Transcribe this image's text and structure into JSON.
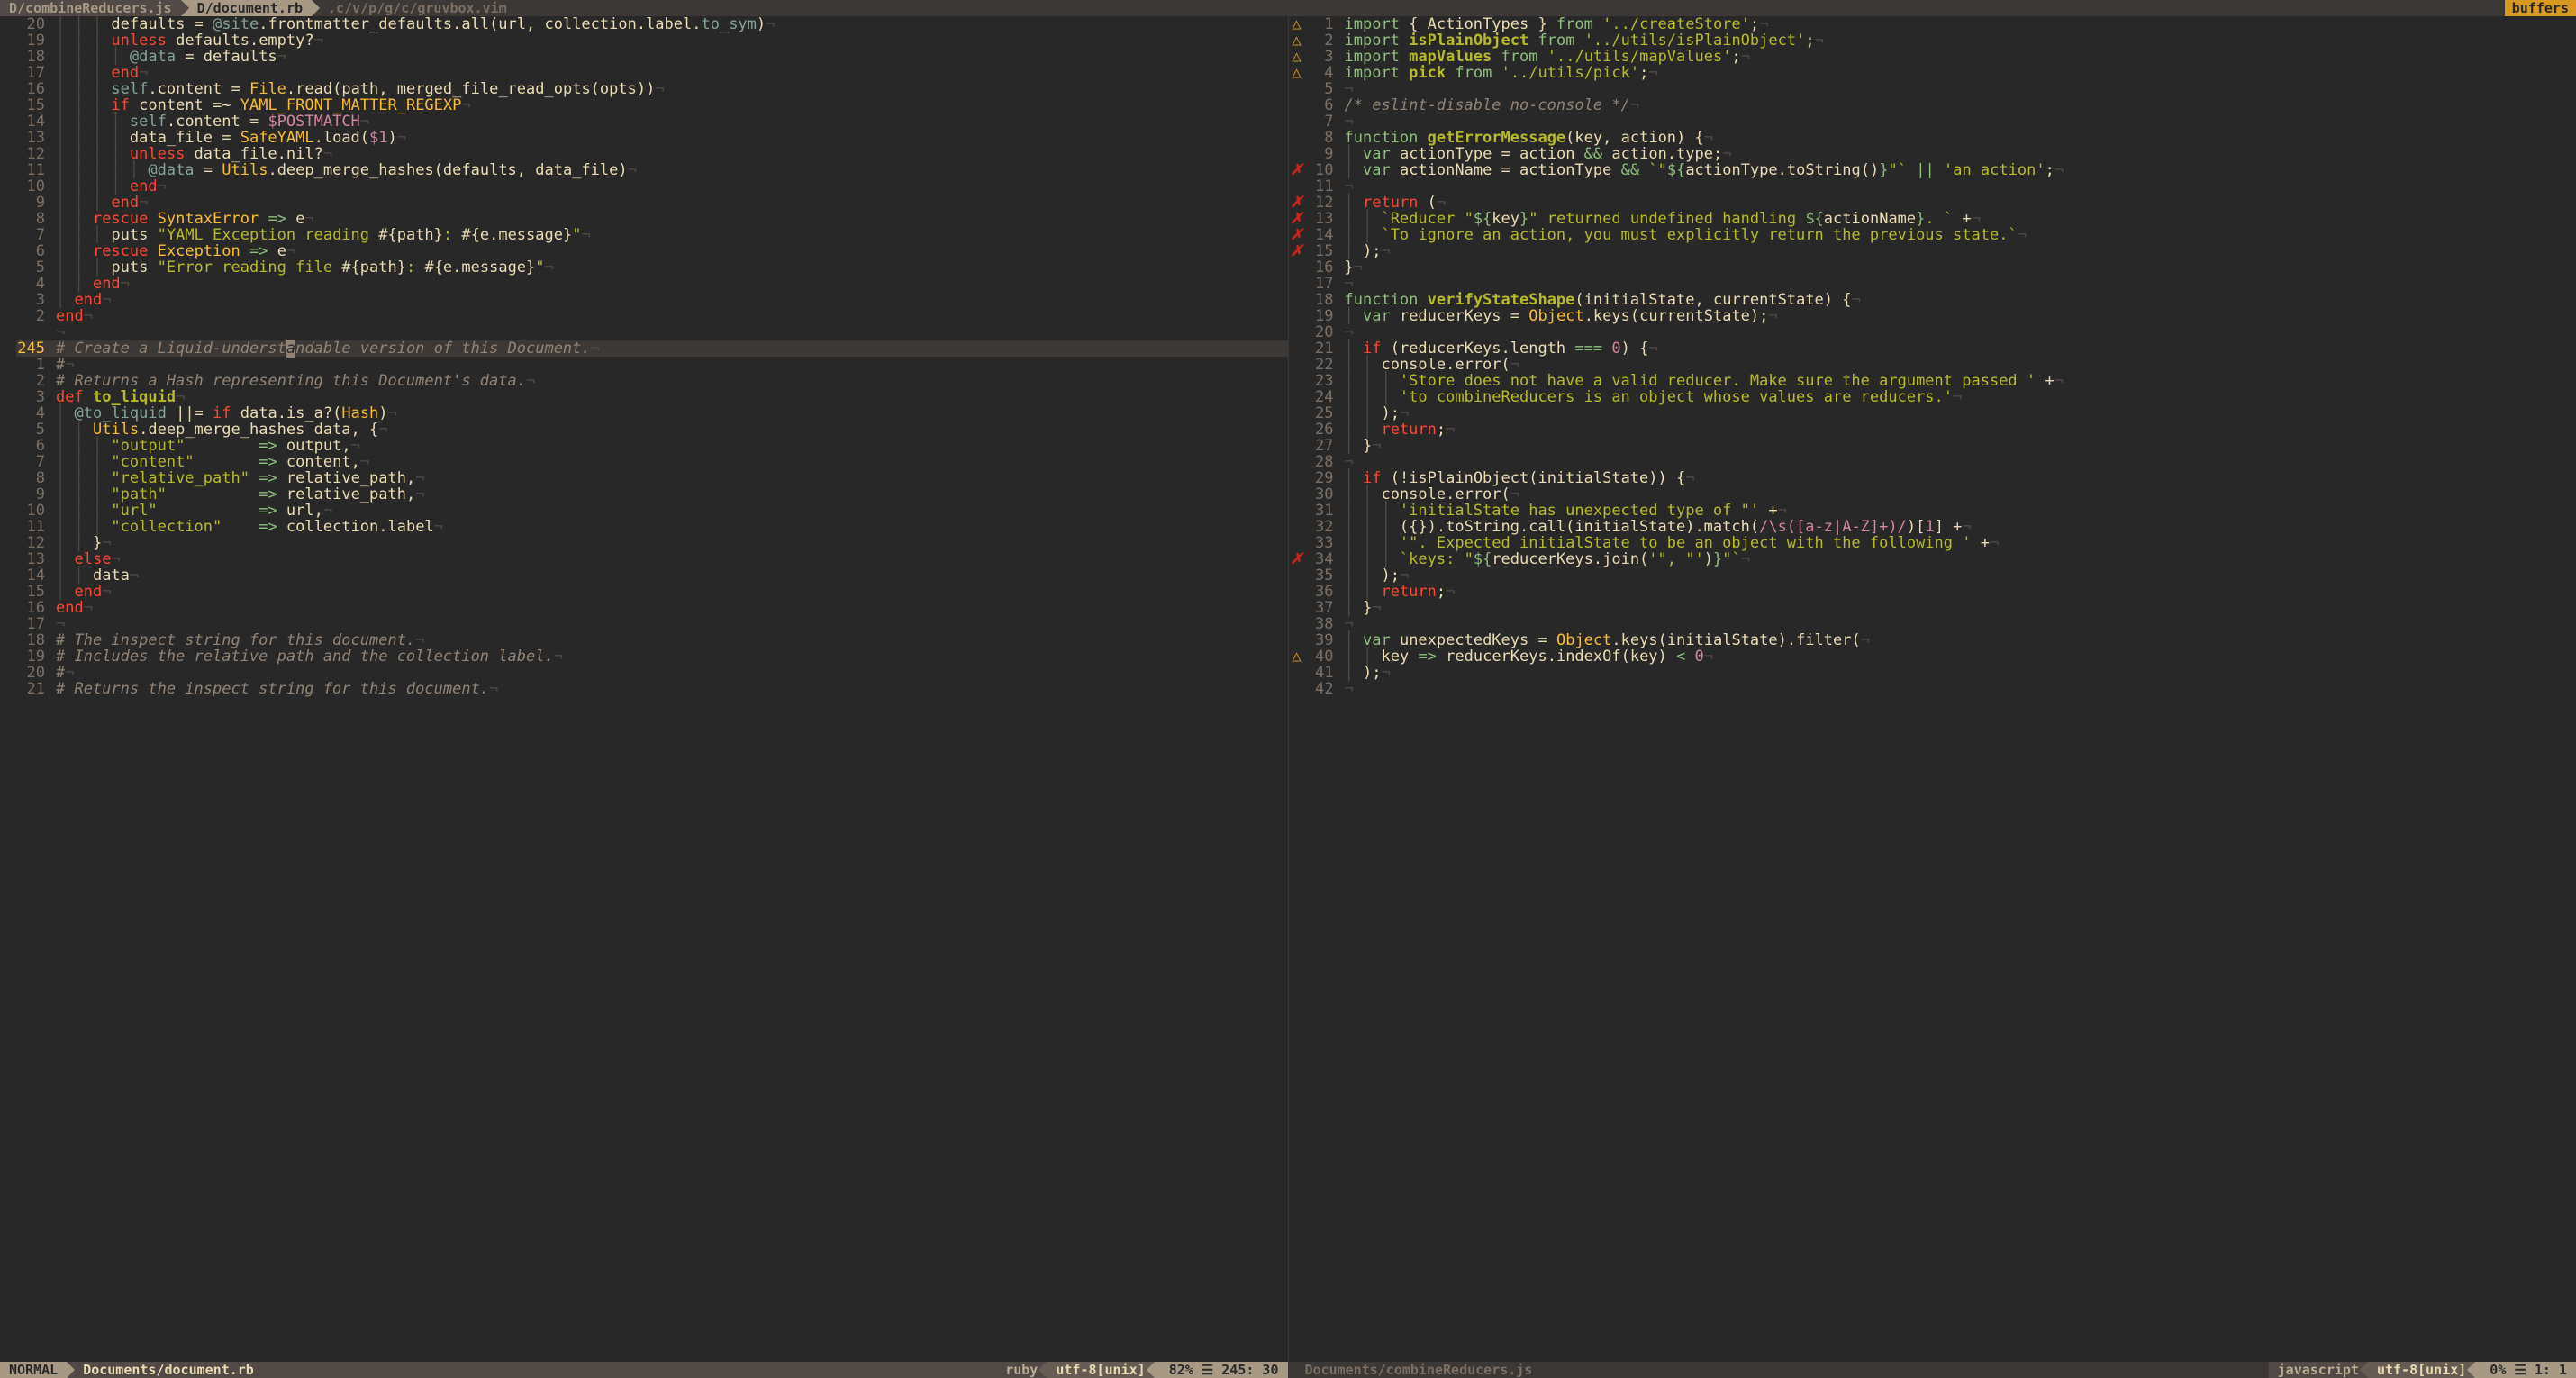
{
  "tabs": {
    "items": [
      {
        "label": "D/combineReducers.js",
        "active": false
      },
      {
        "label": "D/document.rb",
        "active": true
      }
    ],
    "path": ".c/v/p/g/c/gruvbox.vim",
    "right": "buffers"
  },
  "left": {
    "status": {
      "mode": "NORMAL",
      "file": "Documents/document.rb",
      "filetype": "ruby",
      "encoding": "utf-8[unix]",
      "percent": "82%",
      "pos": "245: 30"
    },
    "lines": [
      {
        "n": "20",
        "s": "",
        "html": "<span class='indent'>│ │ │ </span>defaults = <span class='sym'>@site</span>.frontmatter_defaults.all(url, collection.label.<span class='sym'>to_sym</span>)<span class='eol'>¬</span>"
      },
      {
        "n": "19",
        "s": "",
        "html": "<span class='indent'>│ │ │ </span><span class='kw'>unless</span> defaults.empty?<span class='eol'>¬</span>"
      },
      {
        "n": "18",
        "s": "",
        "html": "<span class='indent'>│ │ │ │ </span><span class='sym'>@data</span> = defaults<span class='eol'>¬</span>"
      },
      {
        "n": "17",
        "s": "",
        "html": "<span class='indent'>│ │ │ </span><span class='kw'>end</span><span class='eol'>¬</span>"
      },
      {
        "n": "16",
        "s": "",
        "html": "<span class='indent'>│ │ │ </span><span class='sym'>self</span>.content = <span class='type'>File</span>.read(path, merged_file_read_opts(opts))<span class='eol'>¬</span>"
      },
      {
        "n": "15",
        "s": "",
        "html": "<span class='indent'>│ │ │ </span><span class='kw'>if</span> content =~ <span class='type'>YAML_FRONT_MATTER_REGEXP</span><span class='eol'>¬</span>"
      },
      {
        "n": "14",
        "s": "",
        "html": "<span class='indent'>│ │ │ │ </span><span class='sym'>self</span>.content = <span class='spec'>$POSTMATCH</span><span class='eol'>¬</span>"
      },
      {
        "n": "13",
        "s": "",
        "html": "<span class='indent'>│ │ │ │ </span>data_file = <span class='type'>SafeYAML</span>.load(<span class='spec'>$1</span>)<span class='eol'>¬</span>"
      },
      {
        "n": "12",
        "s": "",
        "html": "<span class='indent'>│ │ │ │ </span><span class='kw'>unless</span> data_file.nil?<span class='eol'>¬</span>"
      },
      {
        "n": "11",
        "s": "",
        "html": "<span class='indent'>│ │ │ │ │ </span><span class='sym'>@data</span> = <span class='type'>Utils</span>.deep_merge_hashes(defaults, data_file)<span class='eol'>¬</span>"
      },
      {
        "n": "10",
        "s": "",
        "html": "<span class='indent'>│ │ │ │ </span><span class='kw'>end</span><span class='eol'>¬</span>"
      },
      {
        "n": "9",
        "s": "",
        "html": "<span class='indent'>│ │ │ </span><span class='kw'>end</span><span class='eol'>¬</span>"
      },
      {
        "n": "8",
        "s": "",
        "html": "<span class='indent'>│ │ </span><span class='kw'>rescue</span> <span class='type'>SyntaxError</span> <span class='op'>=></span> e<span class='eol'>¬</span>"
      },
      {
        "n": "7",
        "s": "",
        "html": "<span class='indent'>│ │ │ </span>puts <span class='str'>\"YAML Exception reading </span><span class='id'>#{path}</span><span class='str'>: </span><span class='id'>#{e.message}</span><span class='str'>\"</span><span class='eol'>¬</span>"
      },
      {
        "n": "6",
        "s": "",
        "html": "<span class='indent'>│ │ </span><span class='kw'>rescue</span> <span class='type'>Exception</span> <span class='op'>=></span> e<span class='eol'>¬</span>"
      },
      {
        "n": "5",
        "s": "",
        "html": "<span class='indent'>│ │ │ </span>puts <span class='str'>\"Error reading file </span><span class='id'>#{path}</span><span class='str'>: </span><span class='id'>#{e.message}</span><span class='str'>\"</span><span class='eol'>¬</span>"
      },
      {
        "n": "4",
        "s": "",
        "html": "<span class='indent'>│ │ </span><span class='kw'>end</span><span class='eol'>¬</span>"
      },
      {
        "n": "3",
        "s": "",
        "html": "<span class='indent'>│ </span><span class='kw'>end</span><span class='eol'>¬</span>"
      },
      {
        "n": "2",
        "s": "",
        "html": "<span class='kw'>end</span><span class='eol'>¬</span>"
      },
      {
        "n": "",
        "s": "",
        "html": "<span class='eol'>¬</span>",
        "abs": ""
      },
      {
        "n": "245",
        "s": "",
        "cursor": true,
        "html": "<span class='com'># Create a Liquid-underst<span class='cursor-ch'>a</span>ndable version of this Document.</span><span class='eol'>¬</span>"
      },
      {
        "n": "1",
        "s": "",
        "html": "<span class='com'>#</span><span class='eol'>¬</span>"
      },
      {
        "n": "2",
        "s": "",
        "html": "<span class='com'># Returns a Hash representing this Document's data.</span><span class='eol'>¬</span>"
      },
      {
        "n": "3",
        "s": "",
        "html": "<span class='kw'>def</span> <span class='fn'>to_liquid</span><span class='eol'>¬</span>"
      },
      {
        "n": "4",
        "s": "",
        "html": "<span class='indent'>│ </span><span class='sym'>@to_liquid</span> ||= <span class='kw'>if</span> data.is_a?(<span class='type'>Hash</span>)<span class='eol'>¬</span>"
      },
      {
        "n": "5",
        "s": "",
        "html": "<span class='indent'>│ │ </span><span class='type'>Utils</span>.deep_merge_hashes data, {<span class='eol'>¬</span>"
      },
      {
        "n": "6",
        "s": "",
        "html": "<span class='indent'>│ │ │ </span><span class='str'>\"output\"</span>        <span class='op'>=></span> output,<span class='eol'>¬</span>"
      },
      {
        "n": "7",
        "s": "",
        "html": "<span class='indent'>│ │ │ </span><span class='str'>\"content\"</span>       <span class='op'>=></span> content,<span class='eol'>¬</span>"
      },
      {
        "n": "8",
        "s": "",
        "html": "<span class='indent'>│ │ │ </span><span class='str'>\"relative_path\"</span> <span class='op'>=></span> relative_path,<span class='eol'>¬</span>"
      },
      {
        "n": "9",
        "s": "",
        "html": "<span class='indent'>│ │ │ </span><span class='str'>\"path\"</span>          <span class='op'>=></span> relative_path,<span class='eol'>¬</span>"
      },
      {
        "n": "10",
        "s": "",
        "html": "<span class='indent'>│ │ │ </span><span class='str'>\"url\"</span>           <span class='op'>=></span> url,<span class='eol'>¬</span>"
      },
      {
        "n": "11",
        "s": "",
        "html": "<span class='indent'>│ │ │ </span><span class='str'>\"collection\"</span>    <span class='op'>=></span> collection.label<span class='eol'>¬</span>"
      },
      {
        "n": "12",
        "s": "",
        "html": "<span class='indent'>│ │ </span>}<span class='eol'>¬</span>"
      },
      {
        "n": "13",
        "s": "",
        "html": "<span class='indent'>│ </span><span class='kw'>else</span><span class='eol'>¬</span>"
      },
      {
        "n": "14",
        "s": "",
        "html": "<span class='indent'>│ │ </span>data<span class='eol'>¬</span>"
      },
      {
        "n": "15",
        "s": "",
        "html": "<span class='indent'>│ </span><span class='kw'>end</span><span class='eol'>¬</span>"
      },
      {
        "n": "16",
        "s": "",
        "html": "<span class='kw'>end</span><span class='eol'>¬</span>"
      },
      {
        "n": "17",
        "s": "",
        "html": "<span class='eol'>¬</span>"
      },
      {
        "n": "18",
        "s": "",
        "html": "<span class='com'># The inspect string for this document.</span><span class='eol'>¬</span>"
      },
      {
        "n": "19",
        "s": "",
        "html": "<span class='com'># Includes the relative path and the collection label.</span><span class='eol'>¬</span>"
      },
      {
        "n": "20",
        "s": "",
        "html": "<span class='com'>#</span><span class='eol'>¬</span>"
      },
      {
        "n": "21",
        "s": "",
        "html": "<span class='com'># Returns the inspect string for this document.</span><span class='eol'>¬</span>"
      }
    ]
  },
  "right": {
    "status": {
      "file": "Documents/combineReducers.js",
      "filetype": "javascript",
      "encoding": "utf-8[unix]",
      "percent": "0%",
      "pos": "1:  1"
    },
    "lines": [
      {
        "n": "1",
        "s": "△",
        "sc": "warn",
        "html": "<span class='op'>import</span> { ActionTypes } <span class='op'>from</span> <span class='str'>'../createStore'</span>;<span class='eol'>¬</span>"
      },
      {
        "n": "2",
        "s": "△",
        "sc": "warn",
        "html": "<span class='op'>import</span> <span class='fn'>isPlainObject</span> <span class='op'>from</span> <span class='str'>'../utils/isPlainObject'</span>;<span class='eol'>¬</span>"
      },
      {
        "n": "3",
        "s": "△",
        "sc": "warn",
        "html": "<span class='op'>import</span> <span class='fn'>mapValues</span> <span class='op'>from</span> <span class='str'>'../utils/mapValues'</span>;<span class='eol'>¬</span>"
      },
      {
        "n": "4",
        "s": "△",
        "sc": "warn",
        "html": "<span class='op'>import</span> <span class='fn'>pick</span> <span class='op'>from</span> <span class='str'>'../utils/pick'</span>;<span class='eol'>¬</span>"
      },
      {
        "n": "5",
        "s": "",
        "html": "<span class='eol'>¬</span>"
      },
      {
        "n": "6",
        "s": "",
        "html": "<span class='com'>/* eslint-disable no-console */</span><span class='eol'>¬</span>"
      },
      {
        "n": "7",
        "s": "",
        "html": "<span class='eol'>¬</span>"
      },
      {
        "n": "8",
        "s": "",
        "html": "<span class='op'>function</span> <span class='fn'>getErrorMessage</span>(<span class='id'>key</span>, <span class='id'>action</span>) {<span class='eol'>¬</span>"
      },
      {
        "n": "9",
        "s": "",
        "html": "<span class='indent'>│ </span><span class='op'>var</span> <span class='id'>actionType</span> = action <span class='op'>&&</span> action.type;<span class='eol'>¬</span>"
      },
      {
        "n": "10",
        "s": "✗",
        "sc": "err",
        "html": "<span class='indent'>│ </span><span class='op'>var</span> <span class='id'>actionName</span> = actionType <span class='op'>&&</span> <span class='str'>`\"</span><span class='op'>${</span>actionType.toString()<span class='op'>}</span><span class='str'>\"`</span> <span class='op'>||</span> <span class='str'>'an action'</span>;<span class='eol'>¬</span>"
      },
      {
        "n": "11",
        "s": "",
        "html": "<span class='eol'>¬</span>"
      },
      {
        "n": "12",
        "s": "✗",
        "sc": "err",
        "html": "<span class='indent'>│ </span><span class='kw'>return</span> (<span class='eol'>¬</span>"
      },
      {
        "n": "13",
        "s": "✗",
        "sc": "err",
        "html": "<span class='indent'>│ │ </span><span class='str'>`Reducer \"</span><span class='op'>${</span>key<span class='op'>}</span><span class='str'>\" returned undefined handling </span><span class='op'>${</span>actionName<span class='op'>}</span><span class='str'>. `</span> +<span class='eol'>¬</span>"
      },
      {
        "n": "14",
        "s": "✗",
        "sc": "err",
        "html": "<span class='indent'>│ │ </span><span class='str'>`To ignore an action, you must explicitly return the previous state.`</span><span class='eol'>¬</span>"
      },
      {
        "n": "15",
        "s": "✗",
        "sc": "err",
        "html": "<span class='indent'>│ </span>);<span class='eol'>¬</span>"
      },
      {
        "n": "16",
        "s": "",
        "html": "}<span class='eol'>¬</span>"
      },
      {
        "n": "17",
        "s": "",
        "html": "<span class='eol'>¬</span>"
      },
      {
        "n": "18",
        "s": "",
        "html": "<span class='op'>function</span> <span class='fn'>verifyStateShape</span>(<span class='id'>initialState</span>, <span class='id'>currentState</span>) {<span class='eol'>¬</span>"
      },
      {
        "n": "19",
        "s": "",
        "html": "<span class='indent'>│ </span><span class='op'>var</span> <span class='id'>reducerKeys</span> = <span class='type'>Object</span>.keys(currentState);<span class='eol'>¬</span>"
      },
      {
        "n": "20",
        "s": "",
        "html": "<span class='eol'>¬</span>"
      },
      {
        "n": "21",
        "s": "",
        "html": "<span class='indent'>│ </span><span class='kw'>if</span> (reducerKeys.length <span class='op'>===</span> <span class='num'>0</span>) {<span class='eol'>¬</span>"
      },
      {
        "n": "22",
        "s": "",
        "html": "<span class='indent'>│ │ </span>console.error(<span class='eol'>¬</span>"
      },
      {
        "n": "23",
        "s": "",
        "html": "<span class='indent'>│ │ │ </span><span class='str'>'Store does not have a valid reducer. Make sure the argument passed '</span> +<span class='eol'>¬</span>"
      },
      {
        "n": "24",
        "s": "",
        "html": "<span class='indent'>│ │ │ </span><span class='str'>'to combineReducers is an object whose values are reducers.'</span><span class='eol'>¬</span>"
      },
      {
        "n": "25",
        "s": "",
        "html": "<span class='indent'>│ │ </span>);<span class='eol'>¬</span>"
      },
      {
        "n": "26",
        "s": "",
        "html": "<span class='indent'>│ │ </span><span class='kw'>return</span>;<span class='eol'>¬</span>"
      },
      {
        "n": "27",
        "s": "",
        "html": "<span class='indent'>│ </span>}<span class='eol'>¬</span>"
      },
      {
        "n": "28",
        "s": "",
        "html": "<span class='eol'>¬</span>"
      },
      {
        "n": "29",
        "s": "",
        "html": "<span class='indent'>│ </span><span class='kw'>if</span> (!isPlainObject(initialState)) {<span class='eol'>¬</span>"
      },
      {
        "n": "30",
        "s": "",
        "html": "<span class='indent'>│ │ </span>console.error(<span class='eol'>¬</span>"
      },
      {
        "n": "31",
        "s": "",
        "html": "<span class='indent'>│ │ │ </span><span class='str'>'initialState has unexpected type of \"'</span> +<span class='eol'>¬</span>"
      },
      {
        "n": "32",
        "s": "",
        "html": "<span class='indent'>│ │ │ </span>({}).toString.call(initialState).match(<span class='spec'>/\\s([a-z|A-Z]+)/</span>)[<span class='num'>1</span>] +<span class='eol'>¬</span>"
      },
      {
        "n": "33",
        "s": "",
        "html": "<span class='indent'>│ │ │ </span><span class='str'>'\". Expected initialState to be an object with the following '</span> +<span class='eol'>¬</span>"
      },
      {
        "n": "34",
        "s": "✗",
        "sc": "err",
        "html": "<span class='indent'>│ │ │ </span><span class='str'>`keys: \"</span><span class='op'>${</span>reducerKeys.join(<span class='str'>'\", \"'</span>)<span class='op'>}</span><span class='str'>\"`</span><span class='eol'>¬</span>"
      },
      {
        "n": "35",
        "s": "",
        "html": "<span class='indent'>│ │ </span>);<span class='eol'>¬</span>"
      },
      {
        "n": "36",
        "s": "",
        "html": "<span class='indent'>│ │ </span><span class='kw'>return</span>;<span class='eol'>¬</span>"
      },
      {
        "n": "37",
        "s": "",
        "html": "<span class='indent'>│ </span>}<span class='eol'>¬</span>"
      },
      {
        "n": "38",
        "s": "",
        "html": "<span class='eol'>¬</span>"
      },
      {
        "n": "39",
        "s": "",
        "html": "<span class='indent'>│ </span><span class='op'>var</span> <span class='id'>unexpectedKeys</span> = <span class='type'>Object</span>.keys(initialState).filter(<span class='eol'>¬</span>"
      },
      {
        "n": "40",
        "s": "△",
        "sc": "warn",
        "html": "<span class='indent'>│ │ </span><span class='id'>key</span> <span class='op'>=></span> reducerKeys.indexOf(key) <span class='op'><</span> <span class='num'>0</span><span class='eol'>¬</span>"
      },
      {
        "n": "41",
        "s": "",
        "html": "<span class='indent'>│ </span>);<span class='eol'>¬</span>"
      },
      {
        "n": "42",
        "s": "",
        "html": "<span class='eol'>¬</span>"
      }
    ]
  }
}
